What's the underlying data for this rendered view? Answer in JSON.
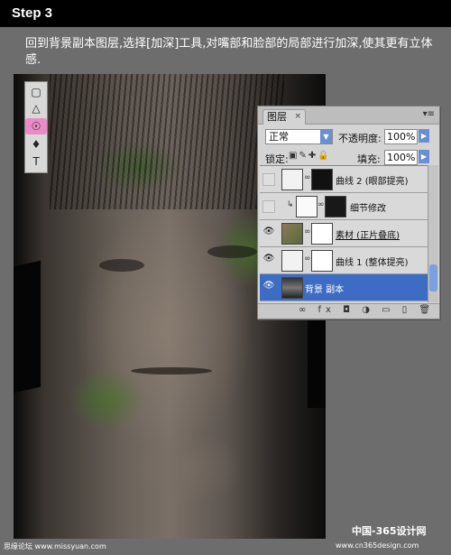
{
  "header": {
    "step_title": "Step 3"
  },
  "instruction": {
    "text": "回到背景副本图层,选择[加深]工具,对嘴部和脸部的局部进行加深,使其更有立体感."
  },
  "toolbar": {
    "tools": [
      {
        "icon": "rectangle-icon",
        "glyph": "▢"
      },
      {
        "icon": "triangle-icon",
        "glyph": "△"
      },
      {
        "icon": "burn-tool-icon",
        "glyph": "☉"
      },
      {
        "icon": "pen-tool-icon",
        "glyph": "♦"
      },
      {
        "icon": "type-tool-icon",
        "glyph": "T"
      }
    ],
    "active_tool": "burn-tool-icon"
  },
  "layers_panel": {
    "tab_label": "图层",
    "close_glyph": "×",
    "blend_mode": "正常",
    "opacity_label": "不透明度:",
    "opacity_value": "100%",
    "lock_label": "锁定:",
    "fill_label": "填充:",
    "fill_value": "100%",
    "layers": [
      {
        "name": "曲线 2 (眼部提亮)",
        "visible": false,
        "selected": false
      },
      {
        "name": "细节修改",
        "visible": false,
        "selected": false
      },
      {
        "name": "素材 (正片叠底)",
        "visible": true,
        "selected": false
      },
      {
        "name": "曲线 1 (整体提亮)",
        "visible": true,
        "selected": false
      },
      {
        "name": "背景 副本",
        "visible": true,
        "selected": true
      }
    ]
  },
  "footer": {
    "left_text": "思缘论坛 www.missyuan.com",
    "right_brand": "中国-365设计网",
    "right_url": "www.cn365design.com"
  },
  "colors": {
    "selected_layer": "#3d6cc4",
    "burn_tool_highlight": "#e98bc6",
    "background": "#6d6d6d"
  }
}
